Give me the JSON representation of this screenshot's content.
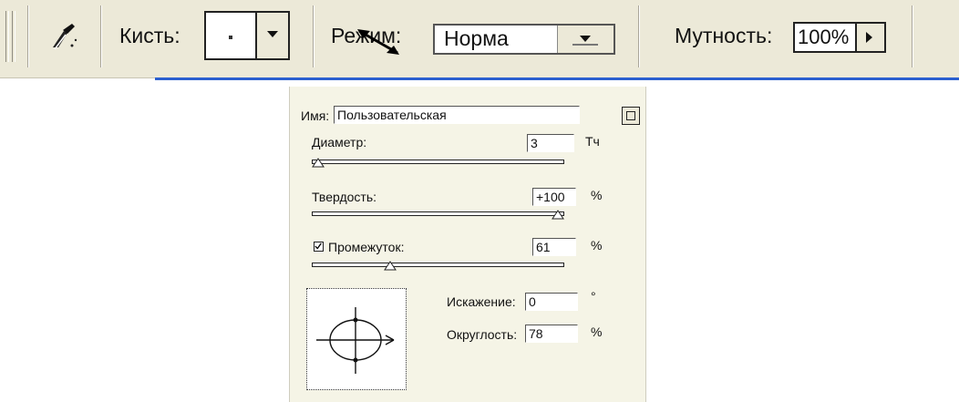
{
  "toolbar": {
    "brush_label": "Кисть:",
    "mode_label": "Режим:",
    "mode_value": "Норма",
    "opacity_label": "Мутность:",
    "opacity_value": "100%",
    "icons": {
      "tool": "brush-tool-icon",
      "brush_dropdown": "chevron-down-icon",
      "mode_dropdown": "chevron-down-icon",
      "opacity_arrow": "chevron-right-icon"
    }
  },
  "panel": {
    "name_label": "Имя:",
    "name_value": "Пользовательская",
    "diameter_label": "Диаметр:",
    "diameter_value": "3",
    "diameter_unit": "Тч",
    "diameter_slider": 0.0,
    "hardness_label": "Твердость:",
    "hardness_value": "+100",
    "hardness_unit": "%",
    "hardness_slider": 1.0,
    "spacing_checked": true,
    "spacing_label": "Промежуток:",
    "spacing_value": "61",
    "spacing_unit": "%",
    "spacing_slider": 0.3,
    "angle_label": "Искажение:",
    "angle_value": "0",
    "angle_unit": "°",
    "roundness_label": "Округлость:",
    "roundness_value": "78",
    "roundness_unit": "%"
  }
}
